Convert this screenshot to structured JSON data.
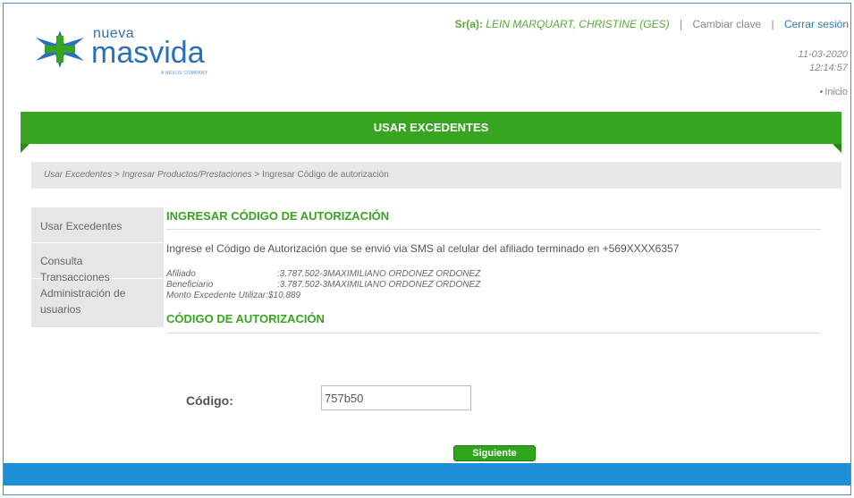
{
  "header": {
    "brand_small": "nueva",
    "brand_big": "masvida",
    "brand_tagline": "A NEXUS COMPANY",
    "user_prefix": "Sr(a):",
    "user_name": "LEIN MARQUART, CHRISTINE (GES)",
    "separator": "|",
    "change_password": "Cambiar clave",
    "logout": "Cerrar sesión",
    "date": "11-03-2020",
    "time": "12:14:57",
    "home_link": "Inicio"
  },
  "banner": {
    "title": "USAR EXCEDENTES"
  },
  "breadcrumb": {
    "item1": "Usar Excedentes",
    "sep": ">",
    "item2": "Ingresar Productos/Prestaciones",
    "item3": "Ingresar Código de autorización"
  },
  "sidebar": {
    "items": [
      {
        "label": "Usar Excedentes"
      },
      {
        "label": "Consulta Transacciones"
      },
      {
        "label": "Administración de usuarios"
      }
    ]
  },
  "main": {
    "title": "INGRESAR CÓDIGO DE AUTORIZACIÓN",
    "instruction": "Ingrese el Código de Autorización que se envió via SMS al celular del afiliado terminado en +569XXXX6357",
    "info": [
      {
        "label": "Afiliado",
        "value": ":3.787.502-3MAXIMILIANO ORDONEZ ORDONEZ"
      },
      {
        "label": "Beneficiario",
        "value": ":3.787.502-3MAXIMILIANO ORDONEZ ORDONEZ"
      },
      {
        "label": "Monto Excedente Utilizar:",
        "value": "$10.889"
      }
    ],
    "subtitle": "CÓDIGO DE AUTORIZACIÓN",
    "code_label": "Código:",
    "code_value": "757b50",
    "next_button": "Siguiente"
  },
  "colors": {
    "green": "#37a51f",
    "blue_footer": "#1e8fd6",
    "brand_blue": "#2a70b8"
  }
}
